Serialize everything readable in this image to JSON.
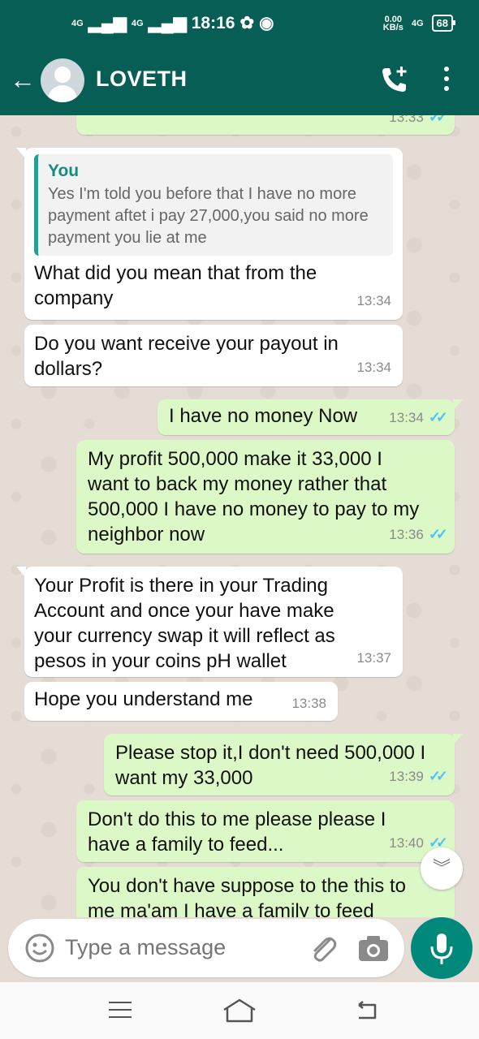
{
  "status_bar": {
    "network1": "4G",
    "network2": "4G",
    "time": "18:16",
    "speed_value": "0.00",
    "speed_unit": "KB/s",
    "network3": "4G",
    "battery": "68"
  },
  "header": {
    "contact_name": "LOVETH"
  },
  "messages": [
    {
      "id": 0,
      "direction": "out",
      "time": "13:33",
      "text": ""
    },
    {
      "id": 1,
      "direction": "in",
      "quote_author": "You",
      "quote_text": "Yes I'm told you before that I have no more payment aftet i pay 27,000,you said no more payment you lie at me",
      "text": "What did you mean that from the company",
      "time": "13:34"
    },
    {
      "id": 2,
      "direction": "in",
      "text": "Do you want receive your payout in dollars?",
      "time": "13:34"
    },
    {
      "id": 3,
      "direction": "out",
      "text": "I have no money Now",
      "time": "13:34"
    },
    {
      "id": 4,
      "direction": "out",
      "text": "My profit 500,000 make it 33,000 I want to back my money rather that 500,000 I have no money to pay to my neighbor now",
      "time": "13:36"
    },
    {
      "id": 5,
      "direction": "in",
      "text": "Your Profit is there in your Trading Account and once your have make your currency swap it will reflect as pesos in your coins pH wallet",
      "time": "13:37"
    },
    {
      "id": 6,
      "direction": "in",
      "text": "Hope you understand me",
      "time": "13:38"
    },
    {
      "id": 7,
      "direction": "out",
      "text": "Please stop it,I don't need 500,000 I want my 33,000",
      "time": "13:39"
    },
    {
      "id": 8,
      "direction": "out",
      "text": "Don't do this to me please please I have a family to feed...",
      "time": "13:40"
    },
    {
      "id": 9,
      "direction": "out",
      "text": "You don't have suppose to the this to me ma'am I have a family to feed",
      "time": ""
    }
  ],
  "composer": {
    "placeholder": "Type a message"
  },
  "colors": {
    "header": "#075e54",
    "outgoing_bubble": "#dcf8c6",
    "incoming_bubble": "#ffffff",
    "read_ticks": "#4fc3f7",
    "mic_button": "#00897b"
  }
}
